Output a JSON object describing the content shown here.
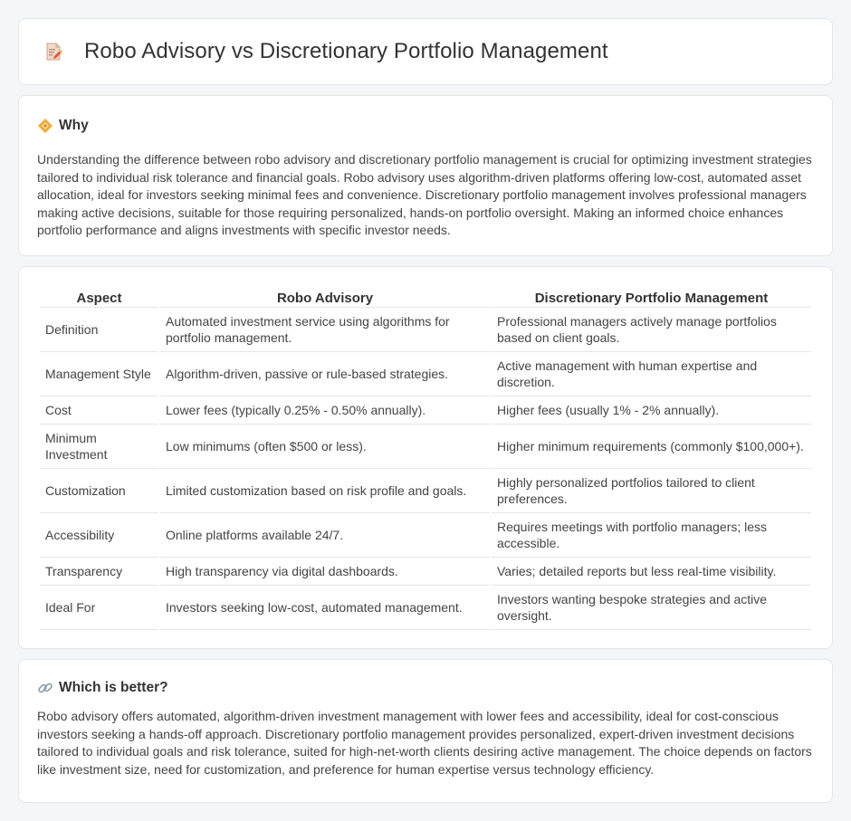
{
  "header": {
    "title": "Robo Advisory vs Discretionary Portfolio Management",
    "icon": "document-pencil-icon"
  },
  "why": {
    "icon": "diamond-sparkle-icon",
    "title": "Why",
    "text": "Understanding the difference between robo advisory and discretionary portfolio management is crucial for optimizing investment strategies tailored to individual risk tolerance and financial goals. Robo advisory uses algorithm-driven platforms offering low-cost, automated asset allocation, ideal for investors seeking minimal fees and convenience. Discretionary portfolio management involves professional managers making active decisions, suitable for those requiring personalized, hands-on portfolio oversight. Making an informed choice enhances portfolio performance and aligns investments with specific investor needs."
  },
  "table": {
    "headers": [
      "Aspect",
      "Robo Advisory",
      "Discretionary Portfolio Management"
    ],
    "rows": [
      [
        "Definition",
        "Automated investment service using algorithms for portfolio management.",
        "Professional managers actively manage portfolios based on client goals."
      ],
      [
        "Management Style",
        "Algorithm-driven, passive or rule-based strategies.",
        "Active management with human expertise and discretion."
      ],
      [
        "Cost",
        "Lower fees (typically 0.25% - 0.50% annually).",
        "Higher fees (usually 1% - 2% annually)."
      ],
      [
        "Minimum Investment",
        "Low minimums (often $500 or less).",
        "Higher minimum requirements (commonly $100,000+)."
      ],
      [
        "Customization",
        "Limited customization based on risk profile and goals.",
        "Highly personalized portfolios tailored to client preferences."
      ],
      [
        "Accessibility",
        "Online platforms available 24/7.",
        "Requires meetings with portfolio managers; less accessible."
      ],
      [
        "Transparency",
        "High transparency via digital dashboards.",
        "Varies; detailed reports but less real-time visibility."
      ],
      [
        "Ideal For",
        "Investors seeking low-cost, automated management.",
        "Investors wanting bespoke strategies and active oversight."
      ]
    ]
  },
  "better": {
    "icon": "link-icon",
    "title": "Which is better?",
    "text": "Robo advisory offers automated, algorithm-driven investment management with lower fees and accessibility, ideal for cost-conscious investors seeking a hands-off approach. Discretionary portfolio management provides personalized, expert-driven investment decisions tailored to individual goals and risk tolerance, suited for high-net-worth clients desiring active management. The choice depends on factors like investment size, need for customization, and preference for human expertise versus technology efficiency."
  }
}
